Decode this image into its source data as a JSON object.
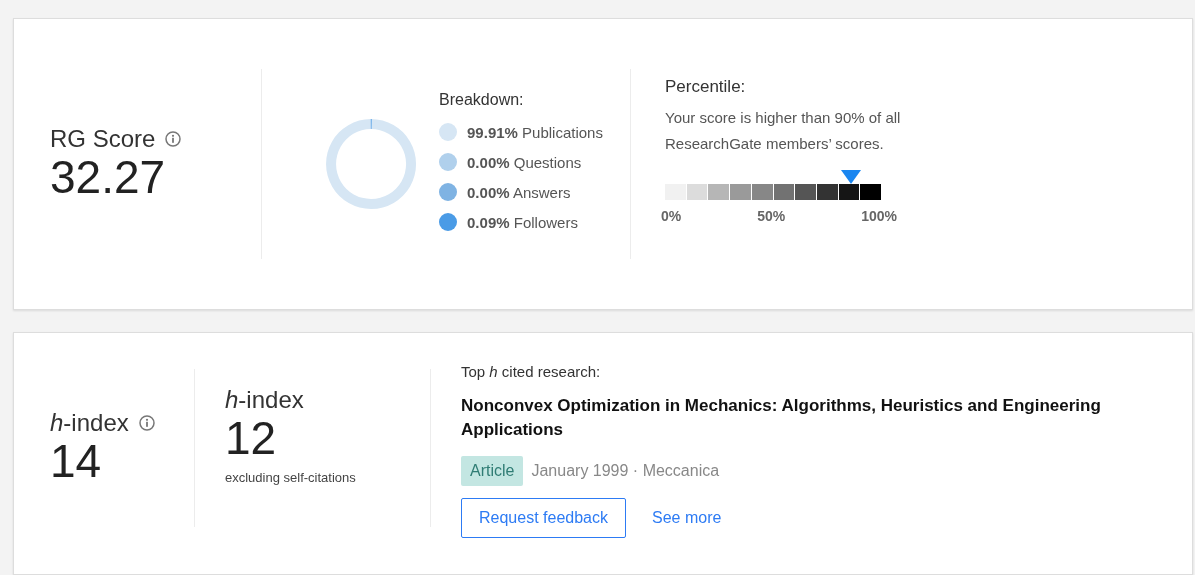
{
  "score_card": {
    "title": "RG Score",
    "value": "32.27",
    "breakdown": {
      "title": "Breakdown:",
      "chart_data": {
        "type": "donut",
        "values": [
          99.91,
          0,
          0,
          0.09
        ]
      },
      "items": [
        {
          "percent": "99.91%",
          "label": "Publications",
          "color": "#d6e6f4"
        },
        {
          "percent": "0.00%",
          "label": "Questions",
          "color": "#b0d0ec"
        },
        {
          "percent": "0.00%",
          "label": "Answers",
          "color": "#7fb3e3"
        },
        {
          "percent": "0.09%",
          "label": "Followers",
          "color": "#4a9be6"
        }
      ]
    },
    "percentile": {
      "title": "Percentile:",
      "text": "Your score is higher than 90% of all ResearchGate members’ scores.",
      "level": 0.9,
      "ticks": [
        "0%",
        "50%",
        "100%"
      ]
    }
  },
  "h_card": {
    "hindex": {
      "title": "*h*-index",
      "value": "14"
    },
    "hindex_excl": {
      "title": "*h*-index",
      "value": "12",
      "note": "excluding self-citations"
    },
    "top": {
      "title": "Top *h* cited research:",
      "paper": "Nonconvex Optimization in Mechanics: Algorithms, Heuristics and Engineering Applications",
      "type": "Article",
      "meta": "January 1999 · Meccanica",
      "buttons": [
        "Request feedback"
      ],
      "link": "See more"
    }
  }
}
